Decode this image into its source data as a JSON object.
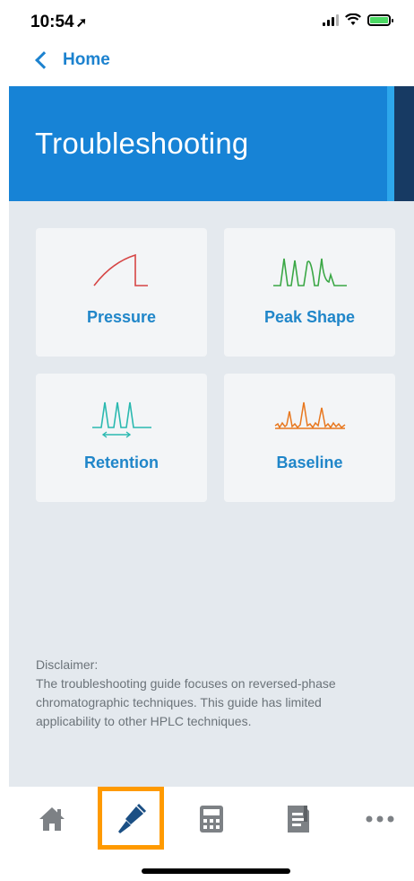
{
  "status_bar": {
    "time": "10:54",
    "location_icon": "location-arrow-icon",
    "signal_icon": "signal-icon",
    "wifi_icon": "wifi-icon",
    "battery_icon": "battery-charging-icon",
    "battery_color": "#4cd964"
  },
  "nav": {
    "back_label": "Home",
    "back_icon": "chevron-left-icon"
  },
  "header": {
    "title": "Troubleshooting",
    "color": "#1783d6"
  },
  "cards": [
    {
      "label": "Pressure",
      "icon": "pressure-curve-icon",
      "icon_color": "#d64545"
    },
    {
      "label": "Peak Shape",
      "icon": "peak-shape-icon",
      "icon_color": "#3aa745"
    },
    {
      "label": "Retention",
      "icon": "retention-peaks-icon",
      "icon_color": "#2ab9b0"
    },
    {
      "label": "Baseline",
      "icon": "noisy-baseline-icon",
      "icon_color": "#e8771e"
    }
  ],
  "disclaimer": {
    "title": "Disclaimer:",
    "text": "The troubleshooting guide focuses on reversed-phase chromatographic techniques. This guide has limited applicability to other HPLC techniques."
  },
  "tab_bar": {
    "items": [
      {
        "icon": "home-icon",
        "selected": false
      },
      {
        "icon": "screwdriver-icon",
        "selected": true
      },
      {
        "icon": "calculator-icon",
        "selected": false
      },
      {
        "icon": "document-icon",
        "selected": false
      },
      {
        "icon": "more-icon",
        "selected": false
      }
    ],
    "highlight_color": "#ff9a00"
  }
}
